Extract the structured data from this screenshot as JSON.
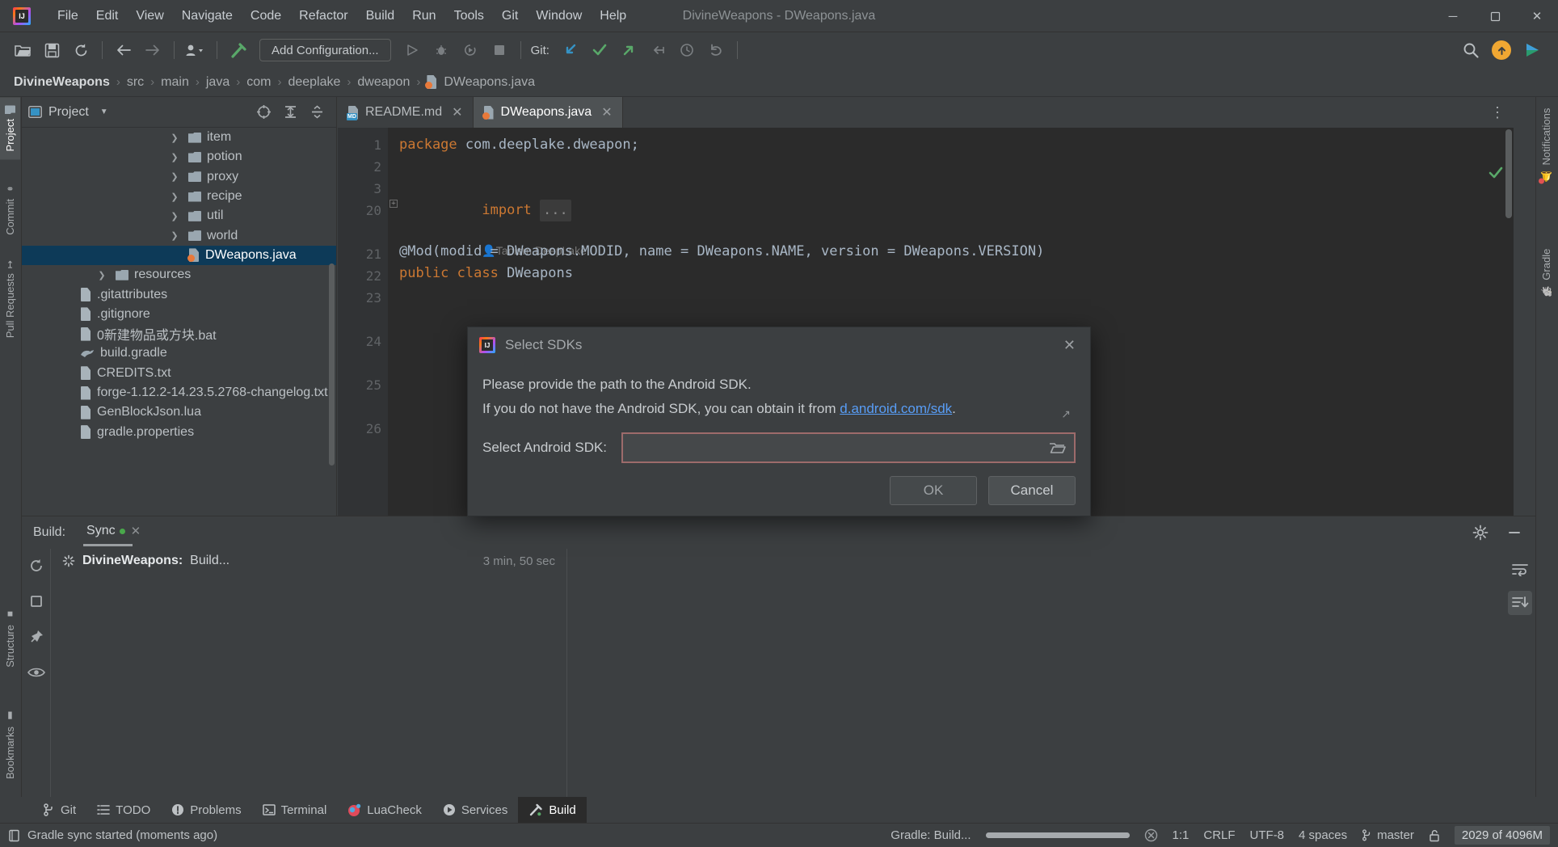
{
  "window": {
    "title": "DivineWeapons - DWeapons.java",
    "minimize": "─",
    "maximize": "❐",
    "close": "✕"
  },
  "menubar": [
    {
      "label": "File"
    },
    {
      "label": "Edit"
    },
    {
      "label": "View"
    },
    {
      "label": "Navigate"
    },
    {
      "label": "Code"
    },
    {
      "label": "Refactor"
    },
    {
      "label": "Build"
    },
    {
      "label": "Run"
    },
    {
      "label": "Tools"
    },
    {
      "label": "Git"
    },
    {
      "label": "Window"
    },
    {
      "label": "Help"
    }
  ],
  "toolbar": {
    "run_config": "Add Configuration...",
    "git_label": "Git:",
    "icons": [
      "open-folder-icon",
      "save-all-icon",
      "sync-icon",
      "back-arrow-icon",
      "forward-arrow-icon",
      "profile-dropdown-icon",
      "build-hammer-icon"
    ]
  },
  "breadcrumb": {
    "items": [
      "DivineWeapons",
      "src",
      "main",
      "java",
      "com",
      "deeplake",
      "dweapon",
      "DWeapons.java"
    ],
    "separator": "›"
  },
  "left_strip": {
    "tabs": [
      {
        "label": "Project",
        "active": true
      },
      {
        "label": "Commit",
        "active": false
      },
      {
        "label": "Pull Requests",
        "active": false
      }
    ],
    "bottom_tabs": [
      {
        "label": "Structure",
        "active": false
      },
      {
        "label": "Bookmarks",
        "active": false
      }
    ]
  },
  "right_strip": {
    "tabs": [
      {
        "label": "Notifications",
        "active": false
      },
      {
        "label": "Gradle",
        "active": false
      }
    ]
  },
  "project_panel": {
    "title": "Project",
    "tree": [
      {
        "label": "item",
        "type": "folder",
        "indent": 3,
        "chevron": true,
        "selected": false
      },
      {
        "label": "potion",
        "type": "folder",
        "indent": 3,
        "chevron": true,
        "selected": false
      },
      {
        "label": "proxy",
        "type": "folder",
        "indent": 3,
        "chevron": true,
        "selected": false
      },
      {
        "label": "recipe",
        "type": "folder",
        "indent": 3,
        "chevron": true,
        "selected": false
      },
      {
        "label": "util",
        "type": "folder",
        "indent": 3,
        "chevron": true,
        "selected": false
      },
      {
        "label": "world",
        "type": "folder",
        "indent": 3,
        "chevron": true,
        "selected": false
      },
      {
        "label": "DWeapons.java",
        "type": "java",
        "indent": 4,
        "chevron": false,
        "selected": true
      },
      {
        "label": "resources",
        "type": "folder",
        "indent": 2,
        "chevron": true,
        "selected": false
      },
      {
        "label": ".gitattributes",
        "type": "txt",
        "indent": 1,
        "chevron": false,
        "selected": false
      },
      {
        "label": ".gitignore",
        "type": "ignore",
        "indent": 1,
        "chevron": false,
        "selected": false
      },
      {
        "label": "0新建物品或方块.bat",
        "type": "txt",
        "indent": 1,
        "chevron": false,
        "selected": false
      },
      {
        "label": "build.gradle",
        "type": "gradle",
        "indent": 1,
        "chevron": false,
        "selected": false
      },
      {
        "label": "CREDITS.txt",
        "type": "txt",
        "indent": 1,
        "chevron": false,
        "selected": false
      },
      {
        "label": "forge-1.12.2-14.23.5.2768-changelog.txt",
        "type": "txt",
        "indent": 1,
        "chevron": false,
        "selected": false
      },
      {
        "label": "GenBlockJson.lua",
        "type": "txt",
        "indent": 1,
        "chevron": false,
        "selected": false
      },
      {
        "label": "gradle.properties",
        "type": "txt",
        "indent": 1,
        "chevron": false,
        "selected": false
      }
    ]
  },
  "editor": {
    "tabs": [
      {
        "label": "README.md",
        "type": "md",
        "active": false,
        "closable": true
      },
      {
        "label": "DWeapons.java",
        "type": "java",
        "active": true,
        "closable": true
      }
    ],
    "close_glyph": "✕",
    "gutter_numbers": [
      "1",
      "2",
      "3",
      "20",
      "",
      "21",
      "22",
      "23",
      "",
      "24",
      "",
      "25",
      "",
      "26"
    ],
    "lines": [
      {
        "num": "1",
        "html": "package_com"
      },
      {
        "num": "2",
        "html": "blank"
      },
      {
        "num": "3",
        "html": "import_fold"
      },
      {
        "num": "20",
        "html": "blank"
      },
      {
        "num": "",
        "html": "inlay_author"
      },
      {
        "num": "21",
        "html": "mod_annotation"
      },
      {
        "num": "22",
        "html": "public_class"
      }
    ],
    "code": {
      "line1_kw": "package",
      "line1_pkg": "com.deeplake.dweapon;",
      "line3_kw": "import",
      "line3_fold": "...",
      "inlay_author": "Taoism DeepLake",
      "line21": "@Mod(modid = DWeapons.MODID, name = DWeapons.NAME, version = DWeapons.VERSION)",
      "line22_kw": "public class",
      "line22_name": "DWeapons"
    }
  },
  "dialog": {
    "title": "Select SDKs",
    "close_glyph": "✕",
    "line1": "Please provide the path to the Android SDK.",
    "line2_prefix": "If you do not have the Android SDK, you can obtain it from ",
    "line2_link": "d.android.com/sdk",
    "line2_suffix": ".",
    "ext_arrow": "↗",
    "field_label": "Select Android SDK:",
    "field_value": "",
    "field_placeholder": "",
    "browse_icon": "folder-open-icon",
    "ok_label": "OK",
    "cancel_label": "Cancel"
  },
  "build_panel": {
    "label": "Build:",
    "tab": "Sync",
    "tab_close": "✕",
    "rows": [
      {
        "title": "DivineWeapons:",
        "detail": "Build...",
        "time": "3 min, 50 sec"
      }
    ],
    "side_icons": [
      "rerun-icon",
      "stop-icon",
      "pin-icon",
      "eye-icon"
    ],
    "right_icons": [
      "soft-wrap-icon",
      "scroll-to-end-icon"
    ],
    "header_icons": [
      "gear-icon",
      "minimize-icon"
    ]
  },
  "bottom_tabs": [
    {
      "label": "Git",
      "icon": "git-branch-icon",
      "active": false
    },
    {
      "label": "TODO",
      "icon": "list-icon",
      "active": false
    },
    {
      "label": "Problems",
      "icon": "error-icon",
      "active": false
    },
    {
      "label": "Terminal",
      "icon": "terminal-icon",
      "active": false
    },
    {
      "label": "LuaCheck",
      "icon": "lua-icon",
      "active": false
    },
    {
      "label": "Services",
      "icon": "play-circle-icon",
      "active": false
    },
    {
      "label": "Build",
      "icon": "hammer-icon",
      "active": true
    }
  ],
  "statusbar": {
    "message": "Gradle sync started (moments ago)",
    "progress_label": "Gradle: Build...",
    "progress_percent": 100,
    "cancel_glyph": "✕",
    "caret": "1:1",
    "line_sep": "CRLF",
    "encoding": "UTF-8",
    "indent": "4 spaces",
    "branch": "master",
    "memory": "2029 of 4096M",
    "lock_icon": "unlocked-icon"
  },
  "colors": {
    "accent_blue": "#589df6",
    "selection_blue": "#0d3a58",
    "error_border": "#9d6b6b",
    "bg": "#3c3f41",
    "editor_bg": "#2b2b2b",
    "green": "#49a84b",
    "orange": "#f0a732"
  }
}
